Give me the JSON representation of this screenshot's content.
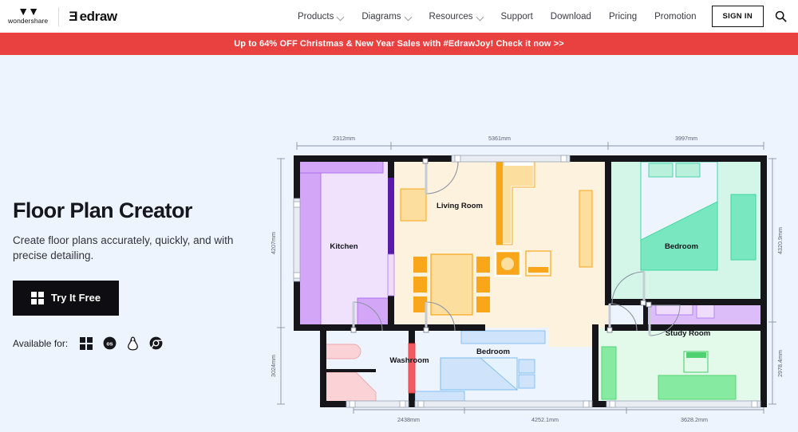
{
  "nav": {
    "brand_primary": "wondershare",
    "brand_mark": "w",
    "edraw_mark": "Ǝ",
    "edraw_word": "edraw",
    "items": [
      {
        "label": "Products",
        "has_caret": true
      },
      {
        "label": "Diagrams",
        "has_caret": true
      },
      {
        "label": "Resources",
        "has_caret": true
      },
      {
        "label": "Support",
        "has_caret": false
      },
      {
        "label": "Download",
        "has_caret": false
      },
      {
        "label": "Pricing",
        "has_caret": false
      },
      {
        "label": "Promotion",
        "has_caret": false
      }
    ],
    "sign_in": "SIGN IN",
    "search_icon": "search-icon"
  },
  "promo": {
    "text": "Up to 64% OFF Christmas & New Year Sales with #EdrawJoy! Check it now >>",
    "background": "#e8413f"
  },
  "hero": {
    "title": "Floor Plan Creator",
    "subtitle": "Create floor plans accurately, quickly, and with precise detailing.",
    "cta_label": "Try It Free",
    "cta_icon": "windows-icon",
    "available_label": "Available for:",
    "platforms": [
      {
        "name": "windows-icon",
        "glyph": ""
      },
      {
        "name": "macos-icon",
        "glyph": "os"
      },
      {
        "name": "linux-icon",
        "glyph": ""
      },
      {
        "name": "chrome-icon",
        "glyph": ""
      }
    ]
  },
  "floorplan": {
    "dimensions_top": [
      "2312mm",
      "5361mm",
      "3997mm"
    ],
    "dimensions_bottom": [
      "2438mm",
      "4252.1mm",
      "3628.2mm"
    ],
    "dimensions_left": [
      "4207mm",
      "3024mm"
    ],
    "dimensions_right": [
      "4320.9mm",
      "2978.4mm"
    ],
    "rooms": [
      {
        "name": "Kitchen",
        "label": "Kitchen",
        "color": "#d9aaf7"
      },
      {
        "name": "Living Room",
        "label": "Living Room",
        "color": "#fdf0d8"
      },
      {
        "name": "Bedroom",
        "label": "Bedroom",
        "color": "#b8f0dc"
      },
      {
        "name": "Washroom",
        "label": "Washroom",
        "color": "#fbd2d5"
      },
      {
        "name": "Bedroom 2",
        "label": "Bedroom",
        "color": "#cfe4fb"
      },
      {
        "name": "Study Room",
        "label": "Study Room",
        "color": "#c4f0c8"
      }
    ],
    "palette": {
      "wall": "#15151a",
      "background": "#eef4fd",
      "kitchen_fill": "#f0e2fd",
      "kitchen_counter": "#d3a6f8",
      "living_fill": "#fdf2dd",
      "living_furniture": "#f9a61a",
      "bedroom_fill": "#d4f6e9",
      "bedroom_furniture": "#79e8c0",
      "washroom_fill": "#eef4fd",
      "washroom_fixture": "#fbd2d5",
      "bedroom2_fill": "#eef4fd",
      "bedroom2_furniture": "#9ccef5",
      "study_fill": "#e3faea",
      "study_furniture": "#86eaa0",
      "closet_fill": "#dcbdfa"
    }
  }
}
